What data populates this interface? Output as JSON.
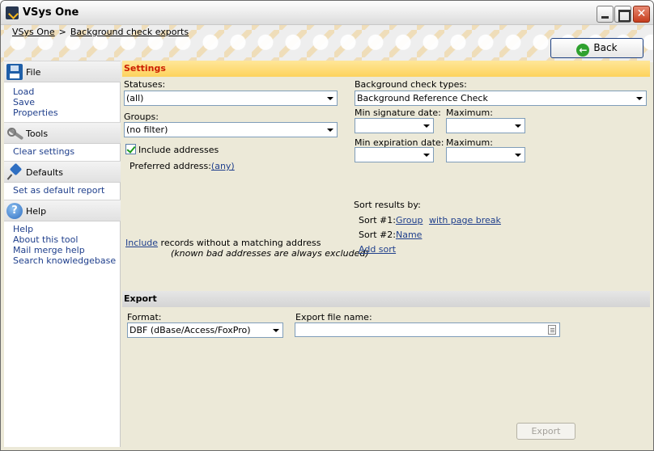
{
  "window": {
    "title": "VSys One"
  },
  "breadcrumb": {
    "root": "VSys One",
    "separator": ">",
    "current": "Background check exports"
  },
  "header": {
    "back_label": "Back"
  },
  "sidebar": {
    "sections": [
      {
        "label": "File",
        "icon": "save-disk-icon",
        "links": [
          "Load",
          "Save",
          "Properties"
        ]
      },
      {
        "label": "Tools",
        "icon": "wrench-icon",
        "links": [
          "Clear settings"
        ]
      },
      {
        "label": "Defaults",
        "icon": "pushpin-icon",
        "links": [
          "Set as default report"
        ]
      },
      {
        "label": "Help",
        "icon": "help-icon",
        "links": [
          "Help",
          "About this tool",
          "Mail merge help",
          "Search knowledgebase"
        ]
      }
    ]
  },
  "settings": {
    "header": "Settings",
    "statuses_label": "Statuses:",
    "statuses_value": "(all)",
    "groups_label": "Groups:",
    "groups_value": "(no filter)",
    "include_addresses_label": "Include addresses",
    "include_addresses_checked": true,
    "preferred_address_label": "Preferred address:",
    "preferred_address_value": "(any)",
    "bg_types_label": "Background check types:",
    "bg_types_value": "Background Reference Check",
    "min_signature_label": "Min signature date:",
    "min_signature_value": "",
    "max_signature_label": "Maximum:",
    "max_signature_value": "",
    "min_expiration_label": "Min expiration date:",
    "min_expiration_value": "",
    "max_expiration_label": "Maximum:",
    "max_expiration_value": "",
    "sort_label": "Sort results by:",
    "sort1_prefix": "Sort #1:",
    "sort1_value": "Group",
    "sort1_option": "with page break",
    "sort2_prefix": "Sort #2:",
    "sort2_value": "Name",
    "add_sort": "Add sort",
    "include_link": "Include",
    "include_rest": " records without a matching address",
    "excluded_note": "(known bad addresses are always excluded)"
  },
  "export": {
    "header": "Export",
    "format_label": "Format:",
    "format_value": "DBF (dBase/Access/FoxPro)",
    "filename_label": "Export file name:",
    "filename_value": "",
    "button_label": "Export",
    "button_enabled": false
  },
  "colors": {
    "settings_header_text": "#cc1f00",
    "settings_header_bg": "#fdd35c",
    "link": "#1f3f8c",
    "check": "#1b9b1b"
  }
}
